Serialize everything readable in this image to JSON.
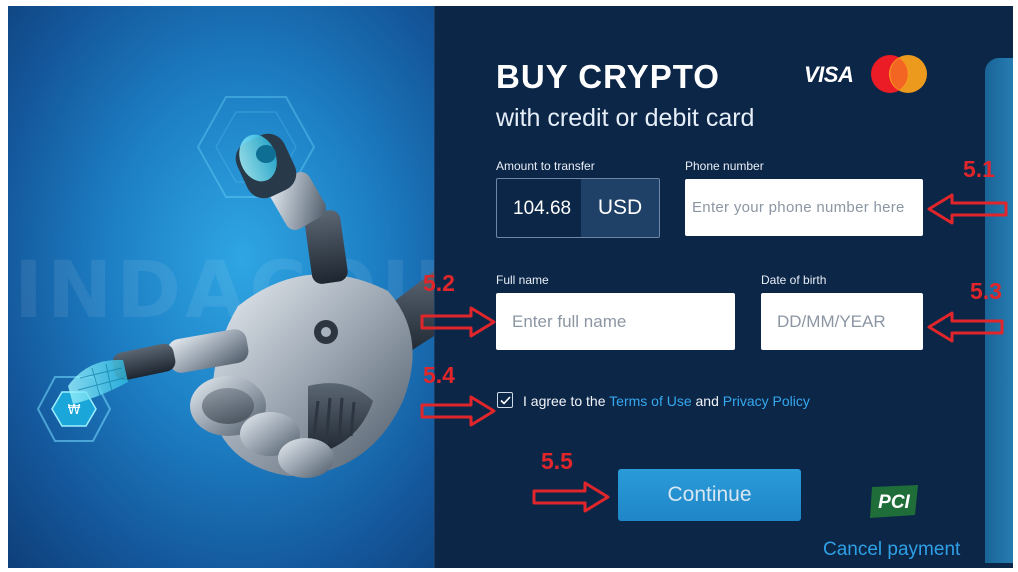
{
  "hero": {
    "watermark_text": "INDACOIN"
  },
  "header": {
    "title": "BUY CRYPTO",
    "subtitle": "with credit or debit card",
    "visa_text": "VISA"
  },
  "form": {
    "amount_label": "Amount to transfer",
    "amount_value": "104.68",
    "currency": "USD",
    "phone_label": "Phone number",
    "phone_placeholder": "Enter your phone number here",
    "fullname_label": "Full name",
    "fullname_placeholder": "Enter full name",
    "dob_label": "Date of birth",
    "dob_placeholder": "DD/MM/YEAR",
    "agree_checked": true,
    "agree_prefix": "I agree to the",
    "terms_link": "Terms of Use",
    "agree_and": "and",
    "privacy_link": "Privacy Policy",
    "continue_label": "Continue",
    "cancel_label": "Cancel payment"
  },
  "badges": {
    "pci_text": "PCI"
  },
  "annotations": {
    "a1": "5.1",
    "a2": "5.2",
    "a3": "5.3",
    "a4": "5.4",
    "a5": "5.5"
  },
  "colors": {
    "panel_bg": "#0c2647",
    "accent_link": "#35a9f0",
    "button": "#1f86c7",
    "annotation": "#e0262b",
    "pci_green": "#1f6e3a"
  },
  "icons": {
    "checkbox": "check-icon",
    "mastercard": "mastercard-logo",
    "robot": "robot-hand-illustration",
    "arrow": "red-outline-arrow"
  }
}
